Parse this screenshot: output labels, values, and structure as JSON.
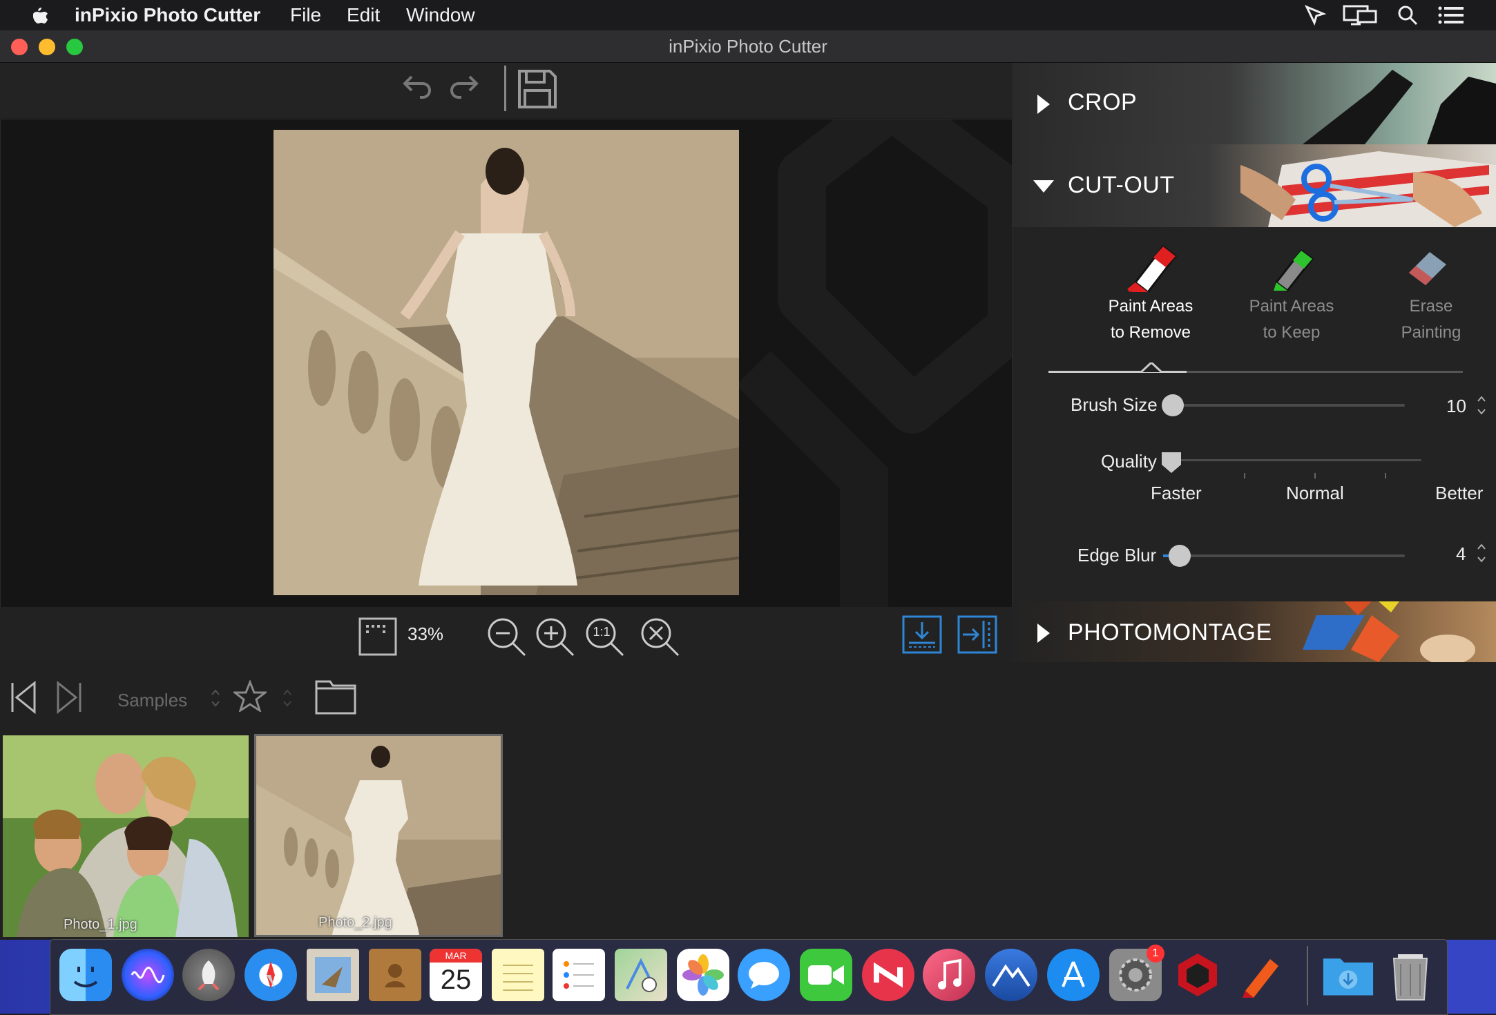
{
  "menubar": {
    "app_name": "inPixio Photo Cutter",
    "items": [
      "File",
      "Edit",
      "Window"
    ]
  },
  "window": {
    "title": "inPixio Photo Cutter"
  },
  "zoom": {
    "level": "33%",
    "one_to_one_label": "1:1"
  },
  "panel": {
    "crop_title": "CROP",
    "cutout_title": "CUT-OUT",
    "photomontage_title": "PHOTOMONTAGE",
    "tools": [
      {
        "line1": "Paint Areas",
        "line2": "to Remove",
        "icon": "red-marker-icon",
        "active": true
      },
      {
        "line1": "Paint Areas",
        "line2": "to Keep",
        "icon": "green-marker-icon",
        "active": false
      },
      {
        "line1": "Erase",
        "line2": "Painting",
        "icon": "eraser-icon",
        "active": false
      }
    ],
    "brush_size": {
      "label": "Brush Size",
      "value": "10"
    },
    "quality": {
      "label": "Quality",
      "options": [
        "Faster",
        "Normal",
        "Better"
      ],
      "selected": "Faster"
    },
    "edge_blur": {
      "label": "Edge Blur",
      "value": "4"
    }
  },
  "browser": {
    "folder_label": "Samples",
    "thumbnails": [
      {
        "label": "Photo_1.jpg",
        "selected": false
      },
      {
        "label": "Photo_2.jpg",
        "selected": true
      }
    ]
  },
  "dock": {
    "calendar_month": "MAR",
    "calendar_day": "25",
    "settings_badge": "1"
  },
  "colors": {
    "accent_blue": "#2f86d6",
    "remove_red": "#e02020",
    "keep_green": "#2ec42e"
  }
}
